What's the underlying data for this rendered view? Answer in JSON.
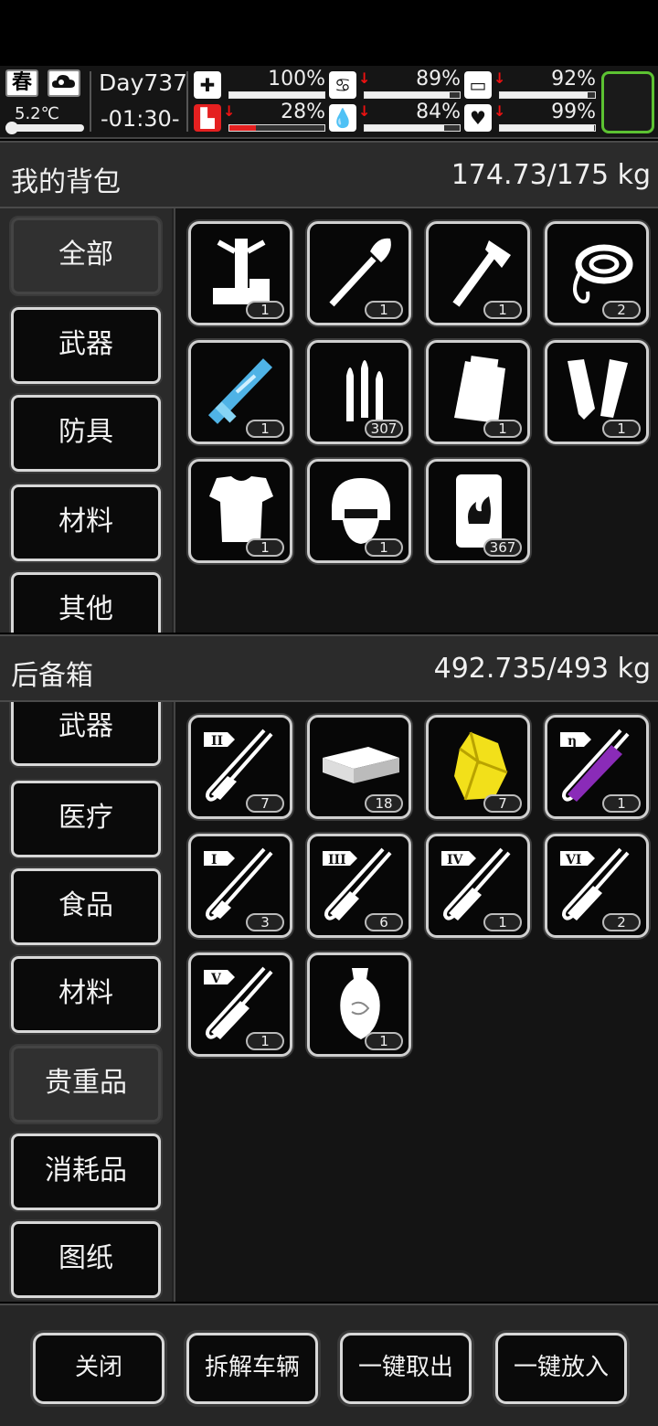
{
  "status": {
    "season": "春",
    "weather_icon": "cloud-icon",
    "temperature": "5.2℃",
    "day": "Day737",
    "time": "-01:30-",
    "stats": [
      {
        "name": "health",
        "icon": "medkit-icon",
        "value": "100%",
        "fraction": 1.0,
        "decreasing": false,
        "color": "#f0f0f0"
      },
      {
        "name": "hunger",
        "icon": "stomach-icon",
        "value": "89%",
        "fraction": 0.89,
        "decreasing": true,
        "color": "#f0f0f0"
      },
      {
        "name": "medicine",
        "icon": "pill-icon",
        "value": "92%",
        "fraction": 0.92,
        "decreasing": true,
        "color": "#f0f0f0"
      },
      {
        "name": "stamina",
        "icon": "boot-icon",
        "value": "28%",
        "fraction": 0.28,
        "decreasing": true,
        "color": "#e52020"
      },
      {
        "name": "thirst",
        "icon": "water-drop-icon",
        "value": "84%",
        "fraction": 0.84,
        "decreasing": true,
        "color": "#f0f0f0"
      },
      {
        "name": "mood",
        "icon": "heart-icon",
        "value": "99%",
        "fraction": 0.99,
        "decreasing": true,
        "color": "#f0f0f0"
      }
    ]
  },
  "backpack": {
    "title": "我的背包",
    "weight": "174.73/175 kg",
    "categories": [
      "全部",
      "武器",
      "防具",
      "材料",
      "其他"
    ],
    "items": [
      {
        "icon": "workbench-tool-icon",
        "count": "1"
      },
      {
        "icon": "shovel-icon",
        "count": "1"
      },
      {
        "icon": "axe-icon",
        "count": "1"
      },
      {
        "icon": "rope-icon",
        "count": "2"
      },
      {
        "icon": "minigun-icon",
        "count": "1"
      },
      {
        "icon": "ammo-icon",
        "count": "307"
      },
      {
        "icon": "backpack-icon",
        "count": "1"
      },
      {
        "icon": "knee-pads-icon",
        "count": "1"
      },
      {
        "icon": "body-armor-icon",
        "count": "1"
      },
      {
        "icon": "helmet-icon",
        "count": "1"
      },
      {
        "icon": "fuel-barrel-icon",
        "count": "367"
      }
    ]
  },
  "trunk": {
    "title": "后备箱",
    "weight": "492.735/493 kg",
    "categories": [
      "武器",
      "医疗",
      "食品",
      "材料",
      "贵重品",
      "消耗品",
      "图纸"
    ],
    "items": [
      {
        "icon": "test-tube-icon",
        "label": "II",
        "count": "7"
      },
      {
        "icon": "cash-bundle-icon",
        "count": "18"
      },
      {
        "icon": "gold-nugget-icon",
        "count": "7"
      },
      {
        "icon": "purple-test-tube-icon",
        "label": "η",
        "count": "1"
      },
      {
        "icon": "test-tube-icon",
        "label": "I",
        "count": "3"
      },
      {
        "icon": "test-tube-icon",
        "label": "III",
        "count": "6"
      },
      {
        "icon": "test-tube-icon",
        "label": "IV",
        "count": "1"
      },
      {
        "icon": "test-tube-icon",
        "label": "VI",
        "count": "2"
      },
      {
        "icon": "test-tube-icon",
        "label": "V",
        "count": "1"
      },
      {
        "icon": "vase-icon",
        "count": "1"
      }
    ]
  },
  "actions": {
    "close": "关闭",
    "dismantle": "拆解车辆",
    "take_all": "一键取出",
    "put_all": "一键放入"
  }
}
